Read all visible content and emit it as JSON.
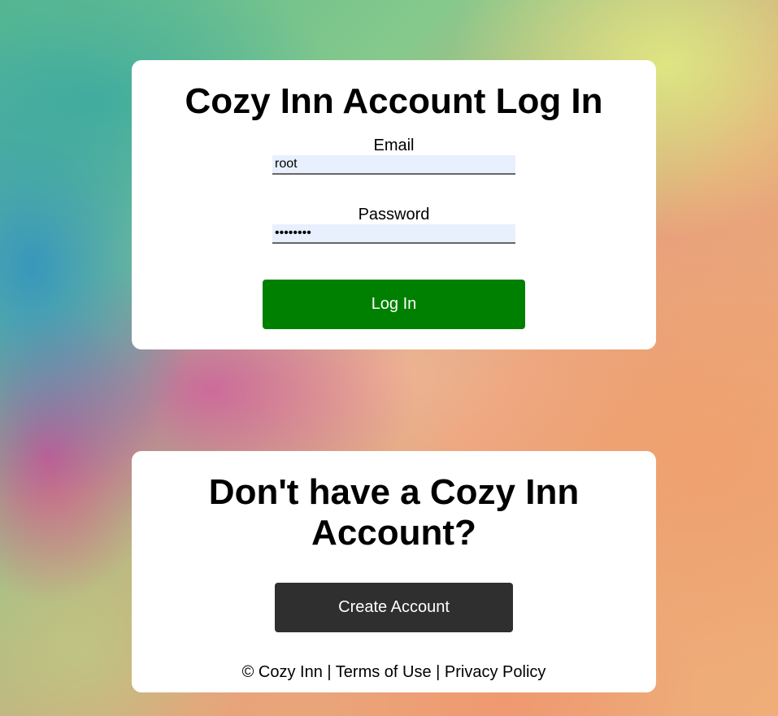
{
  "login": {
    "title": "Cozy Inn Account Log In",
    "email_label": "Email",
    "email_value": "root",
    "password_label": "Password",
    "password_value": "••••••••",
    "login_button": "Log In"
  },
  "signup": {
    "title": "Don't have a Cozy Inn Account?",
    "create_button": "Create Account"
  },
  "footer": {
    "copyright": "© Cozy Inn",
    "separator": "|",
    "terms": "Terms of Use",
    "privacy": "Privacy Policy"
  },
  "colors": {
    "login_button": "#008000",
    "create_button": "#2f2f2f",
    "field_background": "#e8f0fe"
  }
}
